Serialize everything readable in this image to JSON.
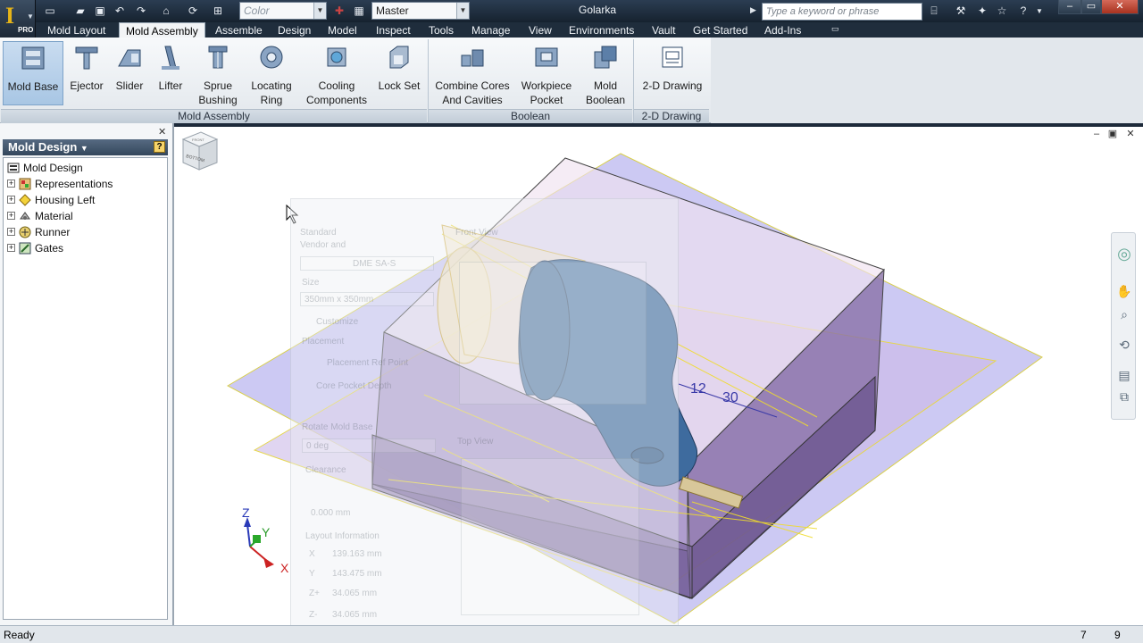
{
  "app": {
    "logo_letter": "I",
    "edition": "PRO",
    "document_title": "Golarka"
  },
  "quick_access": {
    "color_combo": "Color",
    "view_rep_combo": "Master",
    "search_placeholder": "Type a keyword or phrase"
  },
  "menu": {
    "tabs": [
      {
        "label": "Mold Layout"
      },
      {
        "label": "Mold Assembly"
      },
      {
        "label": "Assemble"
      },
      {
        "label": "Design"
      },
      {
        "label": "Model"
      },
      {
        "label": "Inspect"
      },
      {
        "label": "Tools"
      },
      {
        "label": "Manage"
      },
      {
        "label": "View"
      },
      {
        "label": "Environments"
      },
      {
        "label": "Vault"
      },
      {
        "label": "Get Started"
      },
      {
        "label": "Add-Ins"
      }
    ]
  },
  "ribbon": {
    "buttons": [
      {
        "label1": "Mold Base",
        "label2": ""
      },
      {
        "label1": "Ejector",
        "label2": ""
      },
      {
        "label1": "Slider",
        "label2": ""
      },
      {
        "label1": "Lifter",
        "label2": ""
      },
      {
        "label1": "Sprue",
        "label2": "Bushing"
      },
      {
        "label1": "Locating",
        "label2": "Ring"
      },
      {
        "label1": "Cooling",
        "label2": "Components"
      },
      {
        "label1": "Lock Set",
        "label2": ""
      },
      {
        "label1": "Combine Cores",
        "label2": "And Cavities"
      },
      {
        "label1": "Workpiece",
        "label2": "Pocket"
      },
      {
        "label1": "Mold",
        "label2": "Boolean"
      },
      {
        "label1": "2-D Drawing",
        "label2": ""
      }
    ],
    "panels": [
      {
        "title": "Mold Assembly"
      },
      {
        "title": "Boolean"
      },
      {
        "title": "2-D Drawing"
      }
    ]
  },
  "browser": {
    "title": "Mold Design",
    "tree": [
      {
        "label": "Mold Design",
        "icon": "assembly-icon"
      },
      {
        "label": "Representations",
        "icon": "representations-icon"
      },
      {
        "label": "Housing Left",
        "icon": "part-icon"
      },
      {
        "label": "Material",
        "icon": "material-icon"
      },
      {
        "label": "Runner",
        "icon": "runner-icon"
      },
      {
        "label": "Gates",
        "icon": "gates-icon"
      }
    ]
  },
  "viewport": {
    "dimension_labels": [
      "12",
      "30"
    ],
    "triad": {
      "x": "X",
      "y": "Y",
      "z": "Z"
    },
    "viewcube_faces": [
      "FRONT",
      "BOTTOM"
    ]
  },
  "ghost_dialog": {
    "labels": [
      "Standard",
      "Vendor and",
      "Size",
      "350mm x 350mm",
      "Customize",
      "Placement",
      "Placement Ref Point",
      "Core Pocket Depth",
      "Rotate Mold Base",
      "Clearance",
      "Layout Information",
      "X",
      "Y",
      "Z+",
      "Z-",
      "Front View",
      "Top View",
      "DME SA-S",
      "0 deg",
      "0.000 mm",
      "139.163 mm",
      "143.475 mm",
      "34.065 mm",
      "34.065 mm"
    ]
  },
  "status": {
    "text": "Ready",
    "count1": "7",
    "count2": "9"
  },
  "colors": {
    "accent": "#e6b418",
    "ribbon_active": "#a8c6e4",
    "mold_plate": "#8f7fb8",
    "part_blue": "#3e6b9e",
    "guide_yellow": "#f0dc2c"
  }
}
